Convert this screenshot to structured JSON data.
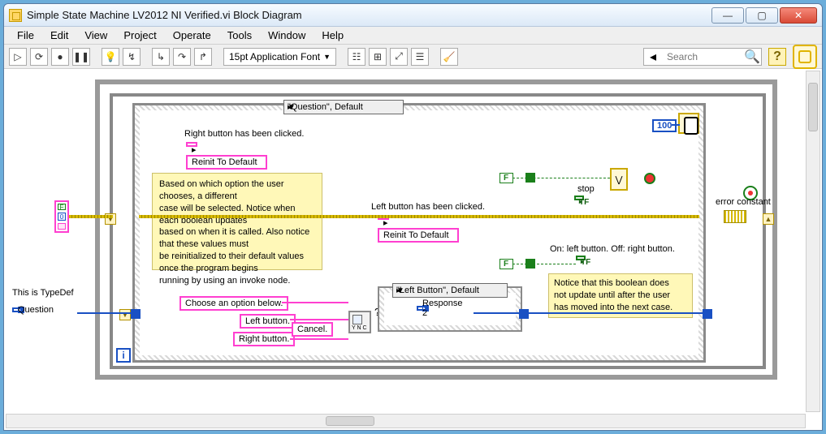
{
  "window": {
    "title": "Simple State Machine LV2012 NI Verified.vi Block Diagram"
  },
  "menubar": {
    "items": [
      "File",
      "Edit",
      "View",
      "Project",
      "Operate",
      "Tools",
      "Window",
      "Help"
    ]
  },
  "toolbar": {
    "font_label": "15pt Application Font",
    "search_placeholder": "Search"
  },
  "typedef": {
    "label": "This is TypeDef",
    "ring": "Question"
  },
  "outer_case": {
    "selector": "\"Question\", Default"
  },
  "inner_case": {
    "selector": "\"Left Button\", Default",
    "ring": "Response 2"
  },
  "invoke": {
    "right_label": "Right button has been clicked.",
    "left_label": "Left button has been clicked.",
    "method": "Reinit To Default"
  },
  "dialog": {
    "msg": "Choose an option below.",
    "btn_left": "Left button.",
    "btn_right": "Right button.",
    "btn_cancel": "Cancel."
  },
  "comment_main": "Based on which option the user chooses, a different\ncase will be selected.  Notice when each boolean updates\nbased on when it is called.  Also notice that these values must\nbe reinitialized to their default values once the program begins\nrunning by using an invoke node.",
  "stop": {
    "label": "stop",
    "tf": "TF"
  },
  "right_indicator": {
    "label": "On: left button. Off: right button.",
    "tf": "TF"
  },
  "right_note": "Notice that this boolean does\nnot update until after the user\nhas moved into the next case.",
  "wait_ms": "100",
  "false_const": "F",
  "error_const_label": "error constant"
}
